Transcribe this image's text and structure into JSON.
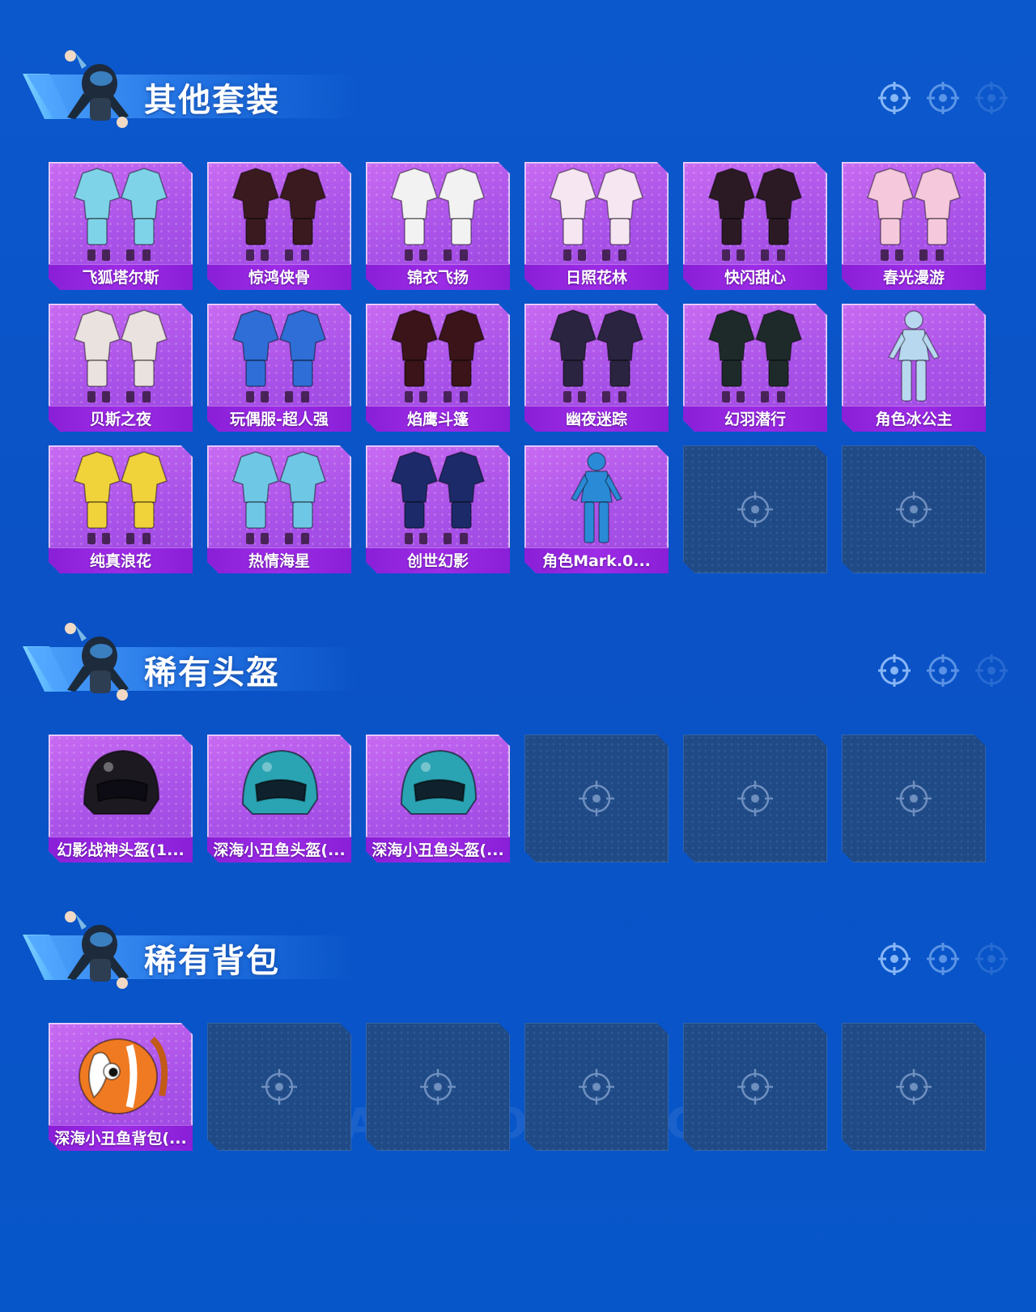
{
  "sections": [
    {
      "title": "其他套装",
      "items": [
        {
          "label": "飞狐塔尔斯",
          "art": "outfit-icon",
          "color": "#7fd3e8"
        },
        {
          "label": "惊鸿侠骨",
          "art": "outfit-icon",
          "color": "#3a1a1e"
        },
        {
          "label": "锦衣飞扬",
          "art": "outfit-icon",
          "color": "#f2f2f2"
        },
        {
          "label": "日照花林",
          "art": "outfit-icon",
          "color": "#f6e6f2"
        },
        {
          "label": "快闪甜心",
          "art": "outfit-icon",
          "color": "#2b1a24"
        },
        {
          "label": "春光漫游",
          "art": "outfit-icon",
          "color": "#f5c8dc"
        },
        {
          "label": "贝斯之夜",
          "art": "outfit-icon",
          "color": "#eae2de"
        },
        {
          "label": "玩偶服-超人强",
          "art": "outfit-icon",
          "color": "#2f6ed6"
        },
        {
          "label": "焰鹰斗篷",
          "art": "outfit-icon",
          "color": "#3a1418"
        },
        {
          "label": "幽夜迷踪",
          "art": "outfit-icon",
          "color": "#2a2440"
        },
        {
          "label": "幻羽潜行",
          "art": "outfit-icon",
          "color": "#1e2a2a"
        },
        {
          "label": "角色冰公主",
          "art": "character-icon",
          "color": "#b8d8f0"
        },
        {
          "label": "纯真浪花",
          "art": "outfit-icon",
          "color": "#f0d23a"
        },
        {
          "label": "热情海星",
          "art": "outfit-icon",
          "color": "#6fc7e6"
        },
        {
          "label": "创世幻影",
          "art": "outfit-icon",
          "color": "#1c2a6a"
        },
        {
          "label": "角色Mark.0...",
          "art": "character-icon",
          "color": "#2a8ad6"
        },
        {
          "label": "",
          "art": "empty-slot-icon",
          "color": ""
        },
        {
          "label": "",
          "art": "empty-slot-icon",
          "color": ""
        }
      ]
    },
    {
      "title": "稀有头盔",
      "items": [
        {
          "label": "幻影战神头盔(1...",
          "art": "helmet-icon",
          "color": "#1c1a20"
        },
        {
          "label": "深海小丑鱼头盔(...",
          "art": "helmet-icon",
          "color": "#2aa3b3"
        },
        {
          "label": "深海小丑鱼头盔(...",
          "art": "helmet-icon",
          "color": "#2aa3b3"
        },
        {
          "label": "",
          "art": "empty-slot-icon",
          "color": ""
        },
        {
          "label": "",
          "art": "empty-slot-icon",
          "color": ""
        },
        {
          "label": "",
          "art": "empty-slot-icon",
          "color": ""
        }
      ]
    },
    {
      "title": "稀有背包",
      "items": [
        {
          "label": "深海小丑鱼背包(...",
          "art": "backpack-icon",
          "color": "#f07a22"
        },
        {
          "label": "",
          "art": "empty-slot-icon",
          "color": ""
        },
        {
          "label": "",
          "art": "empty-slot-icon",
          "color": ""
        },
        {
          "label": "",
          "art": "empty-slot-icon",
          "color": ""
        },
        {
          "label": "",
          "art": "empty-slot-icon",
          "color": ""
        },
        {
          "label": "",
          "art": "empty-slot-icon",
          "color": ""
        }
      ]
    }
  ],
  "watermark": "GAME FOR PEACE",
  "colors": {
    "background": "#0a55c8",
    "card_purple": "#a952e8",
    "label_purple": "#9d2ce6",
    "empty_slot": "#1f4a86"
  }
}
